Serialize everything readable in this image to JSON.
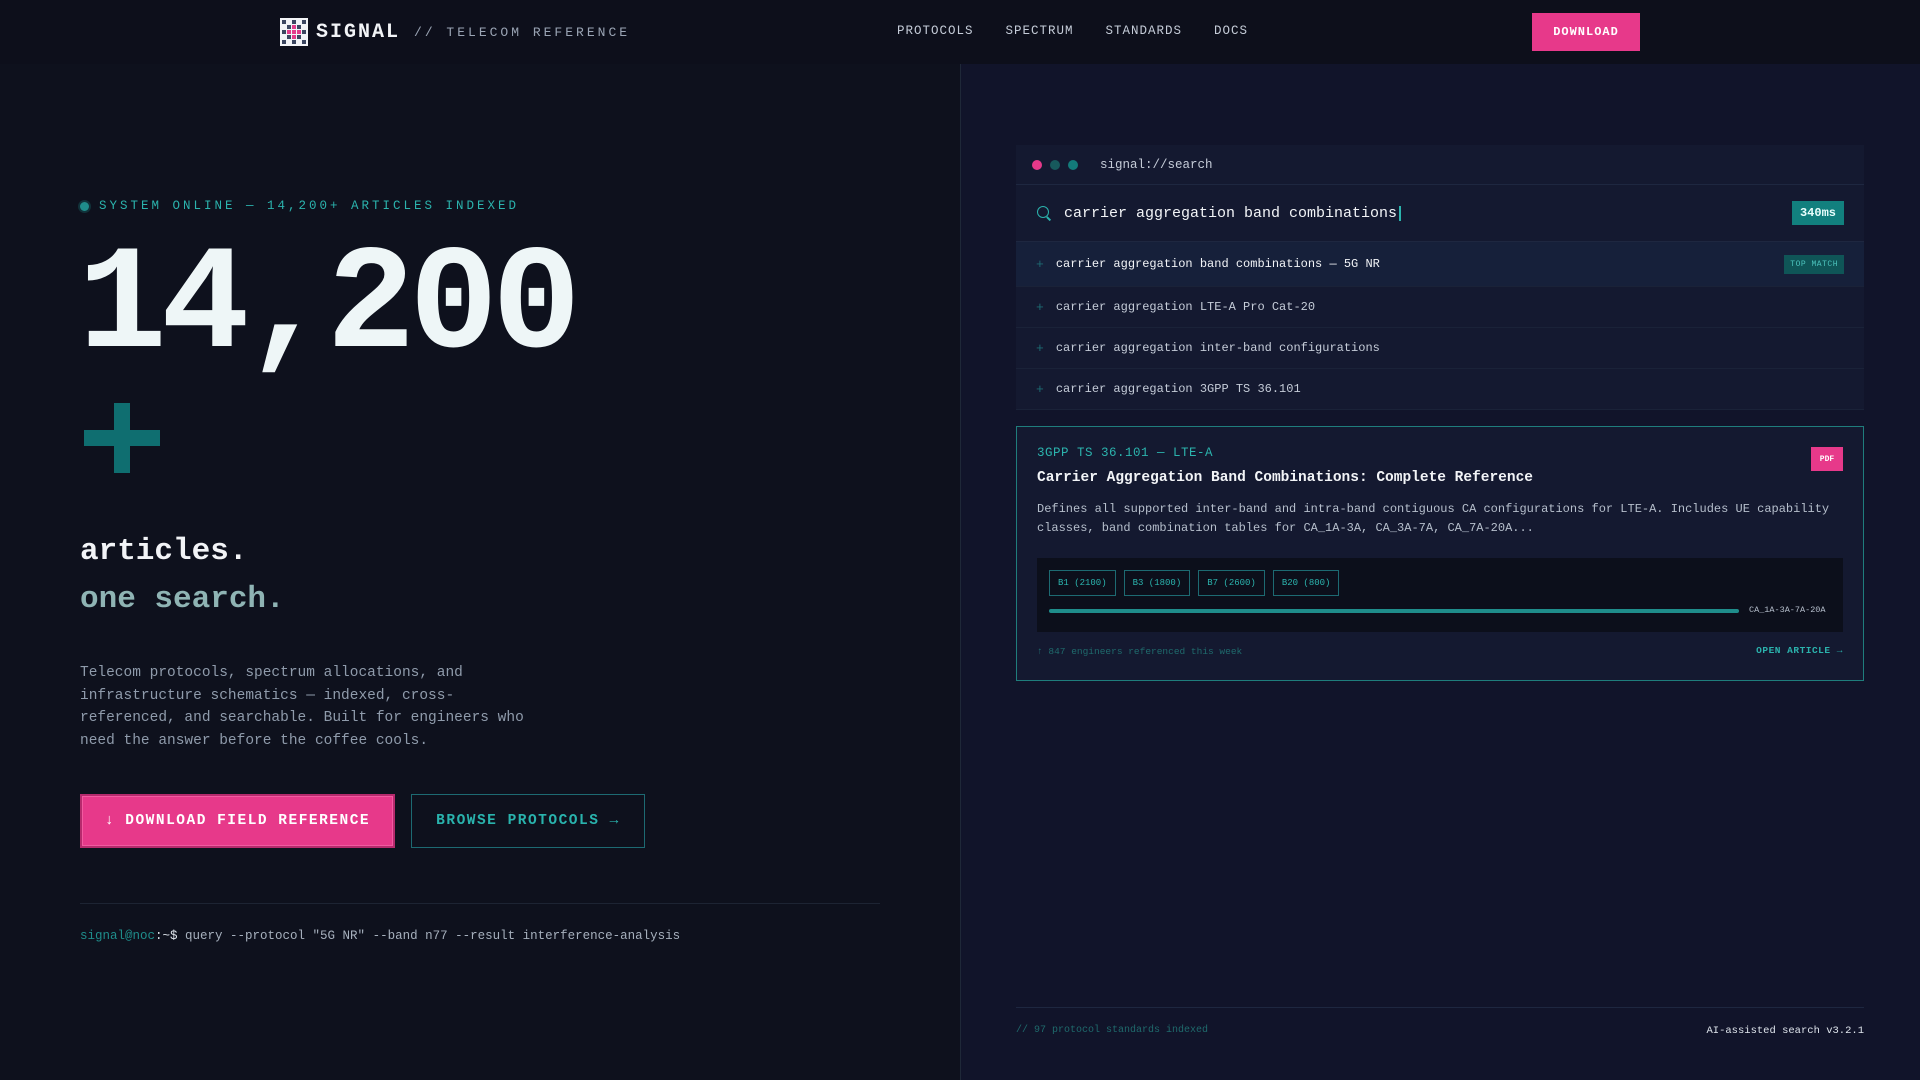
{
  "header": {
    "brand": "SIGNAL",
    "brand_sub": "// TELECOM REFERENCE",
    "nav": [
      "PROTOCOLS",
      "SPECTRUM",
      "STANDARDS",
      "DOCS"
    ],
    "download_label": "DOWNLOAD"
  },
  "hero": {
    "status": "SYSTEM ONLINE — 14,200+ ARTICLES INDEXED",
    "big_number": "14,200",
    "big_suffix": "+",
    "tagline_1": "articles.",
    "tagline_2": "one search.",
    "description": "Telecom protocols, spectrum allocations, and infrastructure schematics — indexed, cross-referenced, and searchable. Built for engineers who need the answer before the coffee cools.",
    "primary_button": "↓ DOWNLOAD FIELD REFERENCE",
    "secondary_button": "BROWSE PROTOCOLS →",
    "command": {
      "prompt": "signal@noc",
      "sep": ":~$",
      "text": " query --protocol \"5G NR\" --band n77 --result interference-analysis"
    }
  },
  "search_window": {
    "url": "signal://search",
    "query": "carrier aggregation band combinations",
    "latency": "340ms",
    "suggestions": [
      {
        "text": "carrier aggregation band combinations — 5G NR",
        "badge": "TOP MATCH"
      },
      {
        "text": "carrier aggregation LTE-A Pro Cat-20"
      },
      {
        "text": "carrier aggregation inter-band configurations"
      },
      {
        "text": "carrier aggregation 3GPP TS 36.101"
      }
    ]
  },
  "article": {
    "kicker": "3GPP TS 36.101 — LTE-A",
    "title": "Carrier Aggregation Band Combinations: Complete Reference",
    "badge": "PDF",
    "description": "Defines all supported inter-band and intra-band contiguous CA configurations for LTE-A. Includes UE capability classes, band combination tables for CA_1A-3A, CA_3A-7A, CA_7A-20A...",
    "bands": [
      "B1 (2100)",
      "B3 (1800)",
      "B7 (2600)",
      "B20 (800)"
    ],
    "combination": "CA_1A-3A-7A-20A",
    "footer_left": "↑ 847 engineers referenced this week",
    "footer_right": "OPEN ARTICLE →"
  },
  "right_footer": {
    "left": "// 97 protocol standards indexed",
    "right": "AI-assisted search v3.2.1"
  },
  "colors": {
    "accent_pink": "#e7398a",
    "accent_teal": "#2bb3ad",
    "background": "#0e111d"
  }
}
